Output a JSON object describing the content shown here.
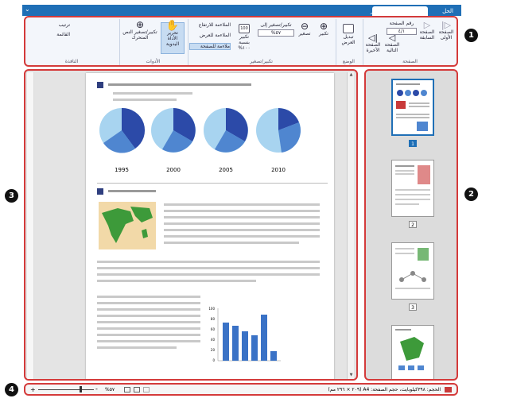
{
  "tabs": {
    "help": "الحل",
    "home": "الصفحة الرئيسية",
    "edit": "تحرير"
  },
  "ribbon": {
    "groups": {
      "page": "الصفحة",
      "view": "الوضع",
      "zoom": "تكبير/تصغير",
      "tools": "الأدوات",
      "window": "النافذة"
    },
    "first_page": "الصفحة الأولى",
    "prev_page": "الصفحة السابقة",
    "next_page": "الصفحة التالية",
    "last_page": "الصفحة الأخيرة",
    "page_number_label": "رقم الصفحة",
    "page_number_value": "٤/١",
    "change_view": "تبديل العرض",
    "zoom_in": "تكبير",
    "zoom_out": "تصغير",
    "zoom_to": "تكبير/تصغير إلى",
    "zoom_value": "٥٧%",
    "zoom_100": "تكبير بنسبة ١٠٠%",
    "fit_height": "الملاءمة للارتفاع",
    "fit_width": "الملاءمة للعرض",
    "fit_page": "ملاءمة للصفحة",
    "hand_tool": "تحرير الأداة اليدوية",
    "free_zoom": "تكبير/تصغير النص المتحرك",
    "arrange": "ترتيب",
    "list": "القائمة"
  },
  "document": {
    "chart_years": [
      "1995",
      "2000",
      "2005",
      "2010"
    ],
    "bar_axis": [
      "100",
      "80",
      "60",
      "40",
      "20",
      "0"
    ]
  },
  "thumbs": {
    "pages": [
      "1",
      "2",
      "3",
      "4"
    ]
  },
  "status": {
    "info": "الحجم: ٣٩٨كيلوبايت، حجم الصفحة: A4 (٢٠٩ × ٢٩٦ مم)",
    "zoom": "٥٧%"
  },
  "callouts": [
    "1",
    "2",
    "3",
    "4"
  ]
}
